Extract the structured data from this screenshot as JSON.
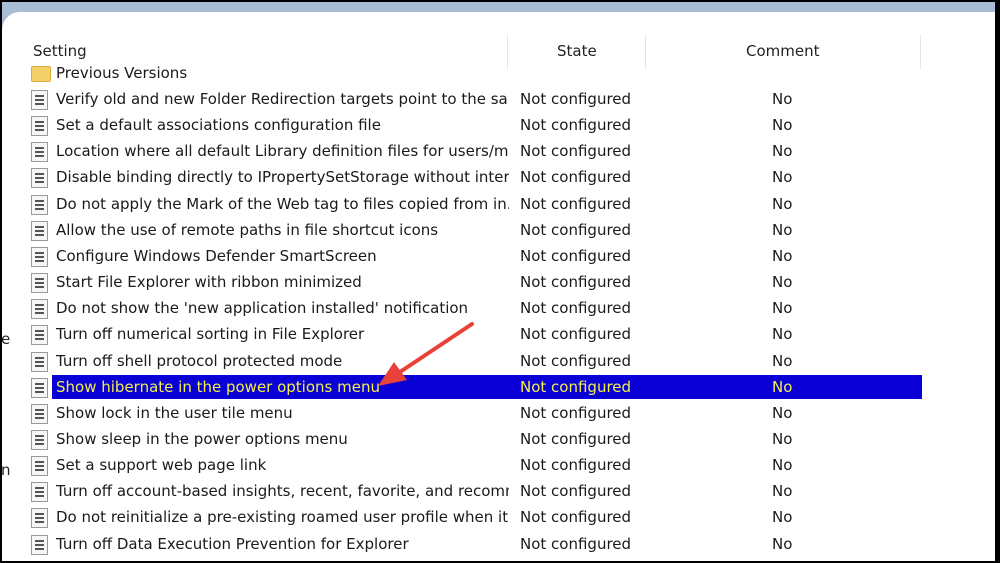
{
  "columns": {
    "setting": "Setting",
    "state": "State",
    "comment": "Comment"
  },
  "folder": "Previous Versions",
  "rows": [
    {
      "name": "Verify old and new Folder Redirection targets point to the sa...",
      "state": "Not configured",
      "comment": "No"
    },
    {
      "name": "Set a default associations configuration file",
      "state": "Not configured",
      "comment": "No"
    },
    {
      "name": "Location where all default Library definition files for users/ma...",
      "state": "Not configured",
      "comment": "No"
    },
    {
      "name": "Disable binding directly to IPropertySetStorage without inter...",
      "state": "Not configured",
      "comment": "No"
    },
    {
      "name": "Do not apply the Mark of the Web tag to files copied from in...",
      "state": "Not configured",
      "comment": "No"
    },
    {
      "name": "Allow the use of remote paths in file shortcut icons",
      "state": "Not configured",
      "comment": "No"
    },
    {
      "name": "Configure Windows Defender SmartScreen",
      "state": "Not configured",
      "comment": "No"
    },
    {
      "name": "Start File Explorer with ribbon minimized",
      "state": "Not configured",
      "comment": "No"
    },
    {
      "name": "Do not show the 'new application installed' notification",
      "state": "Not configured",
      "comment": "No"
    },
    {
      "name": "Turn off numerical sorting in File Explorer",
      "state": "Not configured",
      "comment": "No"
    },
    {
      "name": "Turn off shell protocol protected mode",
      "state": "Not configured",
      "comment": "No"
    },
    {
      "name": "Show hibernate in the power options menu",
      "state": "Not configured",
      "comment": "No",
      "selected": true
    },
    {
      "name": "Show lock in the user tile menu",
      "state": "Not configured",
      "comment": "No"
    },
    {
      "name": "Show sleep in the power options menu",
      "state": "Not configured",
      "comment": "No"
    },
    {
      "name": "Set a support web page link",
      "state": "Not configured",
      "comment": "No"
    },
    {
      "name": "Turn off account-based insights, recent, favorite, and recomm...",
      "state": "Not configured",
      "comment": "No"
    },
    {
      "name": "Do not reinitialize a pre-existing roamed user profile when it i...",
      "state": "Not configured",
      "comment": "No"
    },
    {
      "name": "Turn off Data Execution Prevention for Explorer",
      "state": "Not configured",
      "comment": "No"
    }
  ],
  "edge_text": [
    "e",
    "n"
  ],
  "colors": {
    "selection": "#0a00d6",
    "selection_text": "#f2f04a",
    "arrow": "#e8413a"
  }
}
